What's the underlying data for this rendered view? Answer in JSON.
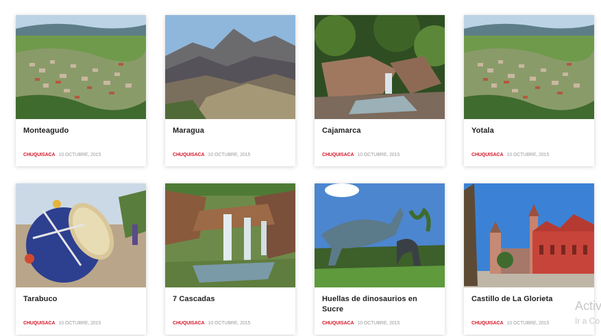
{
  "cards": [
    {
      "title": "Monteagudo",
      "category": "CHUQUISACA",
      "date": "10 OCTUBRE, 2015",
      "image": "town-valley-photo"
    },
    {
      "title": "Maragua",
      "category": "CHUQUISACA",
      "date": "10 OCTUBRE, 2015",
      "image": "mountain-photo"
    },
    {
      "title": "Cajamarca",
      "category": "CHUQUISACA",
      "date": "10 OCTUBRE, 2015",
      "image": "waterfall-rocks-photo"
    },
    {
      "title": "Yotala",
      "category": "CHUQUISACA",
      "date": "10 OCTUBRE, 2015",
      "image": "town-valley-photo"
    },
    {
      "title": "Tarabuco",
      "category": "CHUQUISACA",
      "date": "10 OCTUBRE, 2015",
      "image": "drum-festival-photo"
    },
    {
      "title": "7 Cascadas",
      "category": "CHUQUISACA",
      "date": "10 OCTUBRE, 2015",
      "image": "cascade-photo"
    },
    {
      "title": "Huellas de dinosaurios en Sucre",
      "category": "CHUQUISACA",
      "date": "10 OCTUBRE, 2015",
      "image": "dinosaur-park-photo"
    },
    {
      "title": "Castillo de La Glorieta",
      "category": "CHUQUISACA",
      "date": "10 OCTUBRE, 2015",
      "image": "castle-photo"
    }
  ],
  "watermark": {
    "line1": "Activ",
    "line2": "Ir a Co"
  },
  "colors": {
    "category": "#d4182b",
    "date": "#9a9a9a",
    "title": "#222222"
  }
}
